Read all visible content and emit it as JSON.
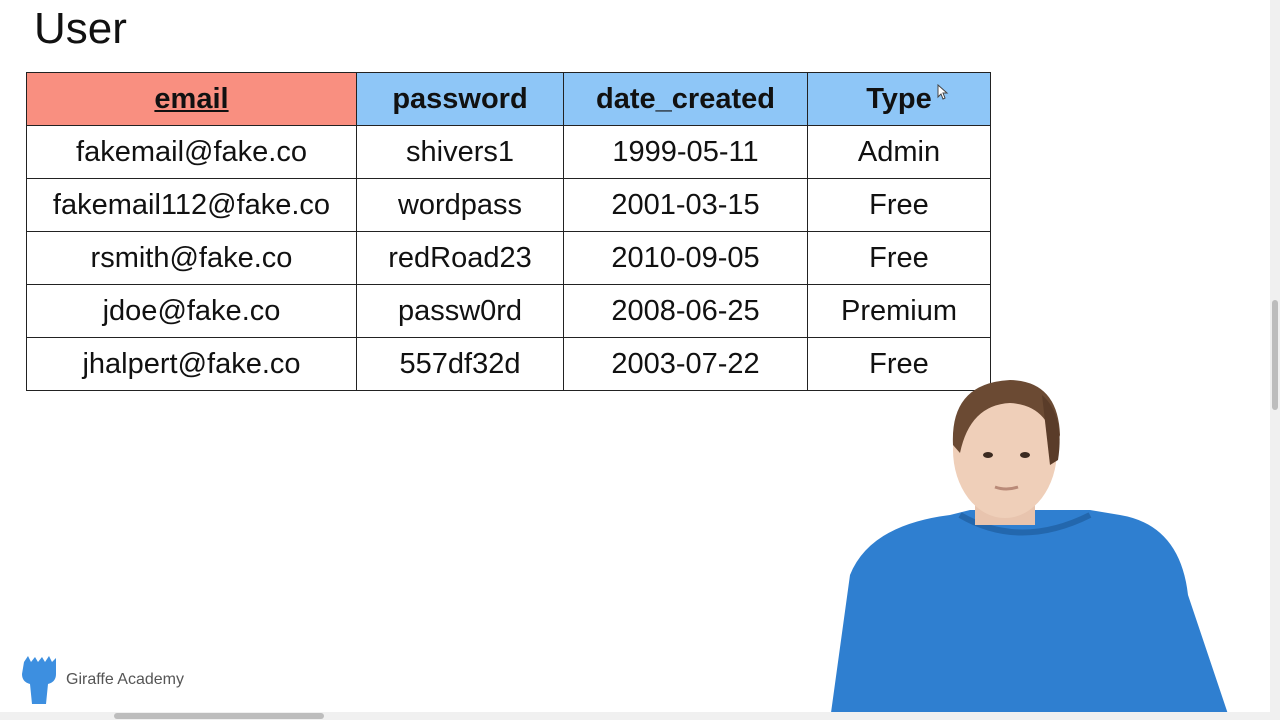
{
  "slide": {
    "title": "User"
  },
  "table": {
    "headers": [
      "email",
      "password",
      "date_created",
      "Type"
    ],
    "rows": [
      [
        "fakemail@fake.co",
        "shivers1",
        "1999-05-11",
        "Admin"
      ],
      [
        "fakemail112@fake.co",
        "wordpass",
        "2001-03-15",
        "Free"
      ],
      [
        "rsmith@fake.co",
        "redRoad23",
        "2010-09-05",
        "Free"
      ],
      [
        "jdoe@fake.co",
        "passw0rd",
        "2008-06-25",
        "Premium"
      ],
      [
        "jhalpert@fake.co",
        "557df32d",
        "2003-07-22",
        "Free"
      ]
    ]
  },
  "branding": {
    "logo_text": "Giraffe Academy",
    "logo_icon": "giraffe-icon"
  },
  "colors": {
    "primary_key_header": "#f98f80",
    "header": "#8ec6f7",
    "presenter_shirt": "#2f7fd0"
  }
}
